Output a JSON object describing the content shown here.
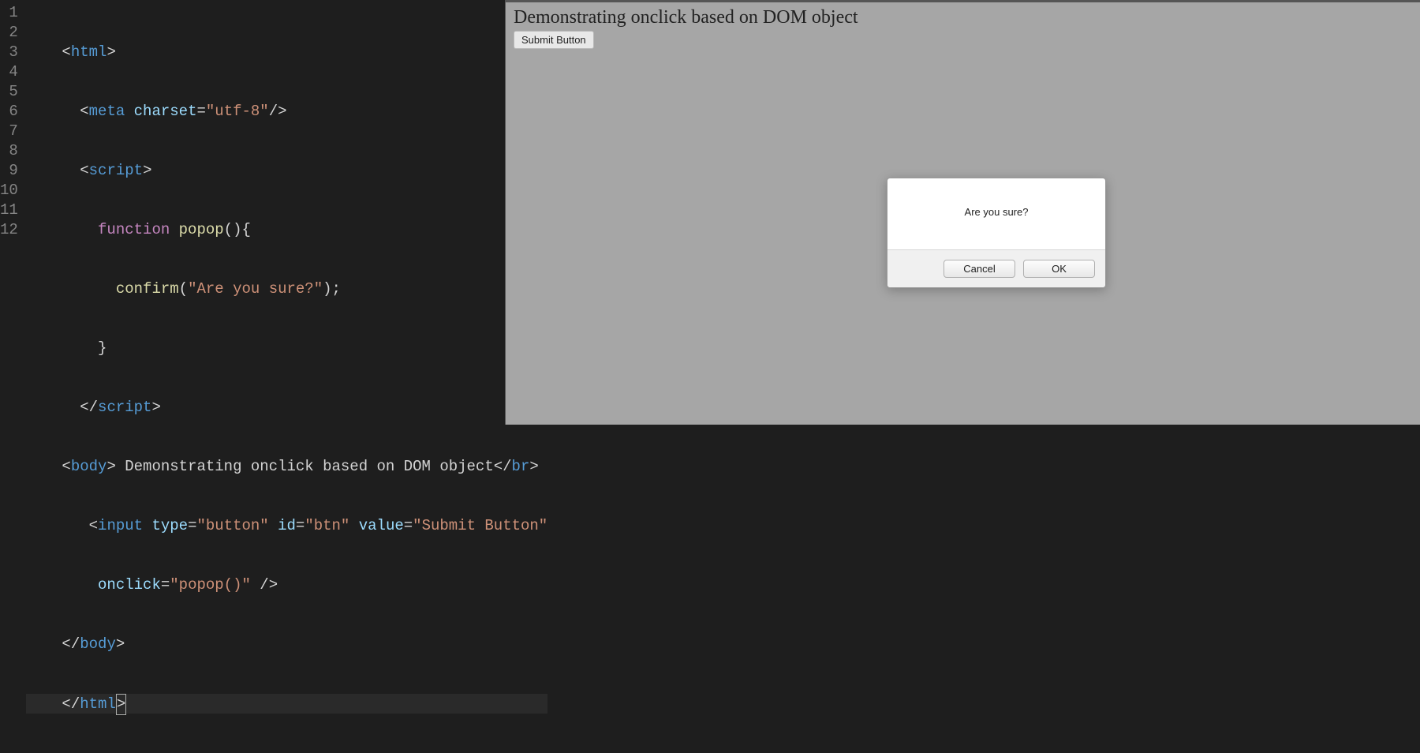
{
  "editor": {
    "lineNumbers": [
      "1",
      "2",
      "3",
      "4",
      "5",
      "6",
      "7",
      "8",
      "9",
      "10",
      "11",
      "12"
    ],
    "code": {
      "line1": {
        "open1": "<",
        "tag": "html",
        "close1": ">"
      },
      "line2": {
        "open1": "<",
        "tag": "meta",
        "sp": " ",
        "attr": "charset",
        "eq": "=",
        "val": "\"utf-8\"",
        "selfclose": "/>"
      },
      "line3": {
        "open1": "<",
        "tag": "script",
        "close1": ">"
      },
      "line4": {
        "kw": "function",
        "sp": " ",
        "fn": "popop",
        "paren": "()",
        "brace": "{"
      },
      "line5": {
        "fn": "confirm",
        "p1": "(",
        "str": "\"Are you sure?\"",
        "p2": ")",
        "semi": ";"
      },
      "line6": {
        "brace": "}"
      },
      "line7": {
        "open1": "</",
        "tag": "script",
        "close1": ">"
      },
      "line8": {
        "open1": "<",
        "tag": "body",
        "close1": ">",
        "sp": " ",
        "text": "Demonstrating onclick based on DOM object",
        "open2": "</",
        "tag2": "br",
        "close2": ">"
      },
      "line9": {
        "open1": "<",
        "tag": "input",
        "sp": " ",
        "attr1": "type",
        "eq": "=",
        "val1": "\"button\"",
        "sp2": " ",
        "attr2": "id",
        "val2": "\"btn\"",
        "sp3": " ",
        "attr3": "value",
        "val3": "\"Submit Button\""
      },
      "line10": {
        "attr": "onclick",
        "eq": "=",
        "val": "\"popop()\"",
        "sp": " ",
        "selfclose": "/>"
      },
      "line11": {
        "open1": "</",
        "tag": "body",
        "close1": ">"
      },
      "line12": {
        "open1": "</",
        "tag": "html",
        "close1": ">"
      }
    }
  },
  "browser": {
    "heading": "Demonstrating onclick based on DOM object",
    "submitLabel": "Submit Button",
    "dialog": {
      "message": "Are you sure?",
      "cancel": "Cancel",
      "ok": "OK"
    }
  }
}
